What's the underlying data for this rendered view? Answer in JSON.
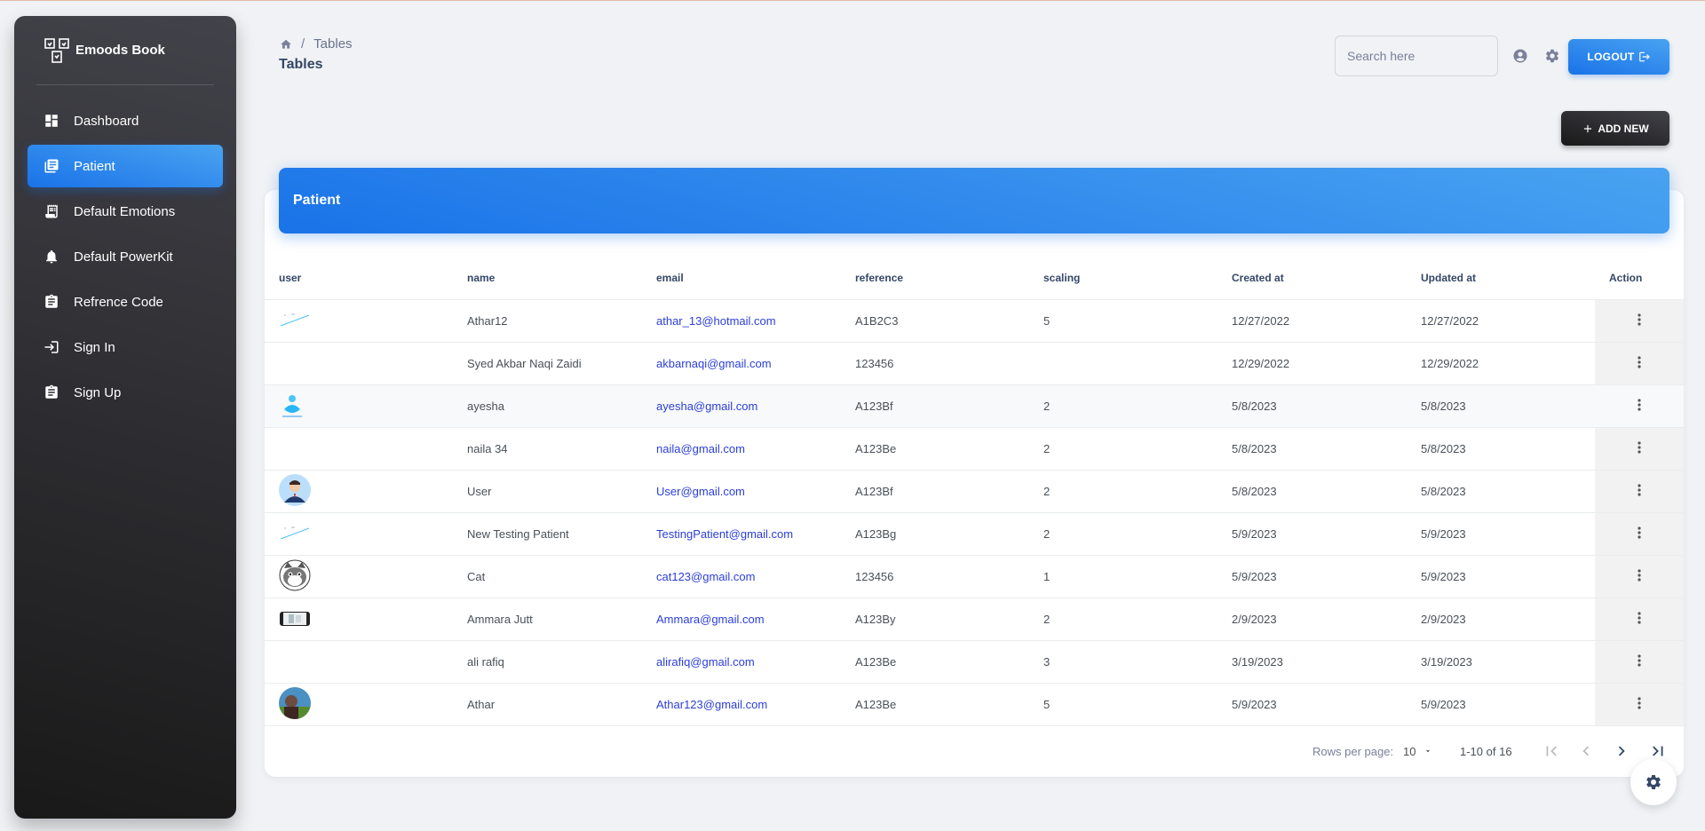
{
  "brand": {
    "name": "Emoods Book"
  },
  "sidebar": {
    "items": [
      {
        "label": "Dashboard",
        "icon": "dashboard-icon",
        "active": false
      },
      {
        "label": "Patient",
        "icon": "table-icon",
        "active": true
      },
      {
        "label": "Default Emotions",
        "icon": "receipt-icon",
        "active": false
      },
      {
        "label": "Default PowerKit",
        "icon": "bell-icon",
        "active": false
      },
      {
        "label": "Refrence Code",
        "icon": "assignment-icon",
        "active": false
      },
      {
        "label": "Sign In",
        "icon": "login-icon",
        "active": false
      },
      {
        "label": "Sign Up",
        "icon": "assignment-icon",
        "active": false
      }
    ]
  },
  "header": {
    "breadcrumb_current": "Tables",
    "page_title": "Tables",
    "search_placeholder": "Search here",
    "logout_label": "LOGOUT"
  },
  "toolbar": {
    "add_new_label": "ADD NEW"
  },
  "card": {
    "title": "Patient"
  },
  "table": {
    "columns": [
      "user",
      "name",
      "email",
      "reference",
      "scaling",
      "Created at",
      "Updated at",
      "Action"
    ],
    "rows": [
      {
        "avatar": "line-sketch",
        "name": "Athar12",
        "email": "athar_13@hotmail.com",
        "reference": "A1B2C3",
        "scaling": "5",
        "created": "12/27/2022",
        "updated": "12/27/2022"
      },
      {
        "avatar": "none",
        "name": "Syed Akbar Naqi Zaidi",
        "email": "akbarnaqi@gmail.com",
        "reference": "123456",
        "scaling": "",
        "created": "12/29/2022",
        "updated": "12/29/2022"
      },
      {
        "avatar": "logo",
        "name": "ayesha",
        "email": "ayesha@gmail.com",
        "reference": "A123Bf",
        "scaling": "2",
        "created": "5/8/2023",
        "updated": "5/8/2023"
      },
      {
        "avatar": "none",
        "name": "naila 34",
        "email": "naila@gmail.com",
        "reference": "A123Be",
        "scaling": "2",
        "created": "5/8/2023",
        "updated": "5/8/2023"
      },
      {
        "avatar": "person",
        "name": "User",
        "email": "User@gmail.com",
        "reference": "A123Bf",
        "scaling": "2",
        "created": "5/8/2023",
        "updated": "5/8/2023"
      },
      {
        "avatar": "line-sketch",
        "name": "New Testing Patient",
        "email": "TestingPatient@gmail.com",
        "reference": "A123Bg",
        "scaling": "2",
        "created": "5/9/2023",
        "updated": "5/9/2023"
      },
      {
        "avatar": "cat",
        "name": "Cat",
        "email": "cat123@gmail.com",
        "reference": "123456",
        "scaling": "1",
        "created": "5/9/2023",
        "updated": "5/9/2023"
      },
      {
        "avatar": "photo-strip",
        "name": "Ammara Jutt",
        "email": "Ammara@gmail.com",
        "reference": "A123By",
        "scaling": "2",
        "created": "2/9/2023",
        "updated": "2/9/2023"
      },
      {
        "avatar": "none",
        "name": "ali rafiq",
        "email": "alirafiq@gmail.com",
        "reference": "A123Be",
        "scaling": "3",
        "created": "3/19/2023",
        "updated": "3/19/2023"
      },
      {
        "avatar": "photo",
        "name": "Athar",
        "email": "Athar123@gmail.com",
        "reference": "A123Be",
        "scaling": "5",
        "created": "5/9/2023",
        "updated": "5/9/2023"
      }
    ]
  },
  "pagination": {
    "rows_per_page_label": "Rows per page:",
    "rows_per_page": "10",
    "range_label": "1-10 of 16"
  },
  "colors": {
    "accent": "#1a73e8",
    "sidebar_dark": "#191919",
    "link": "#2b3ed9"
  }
}
